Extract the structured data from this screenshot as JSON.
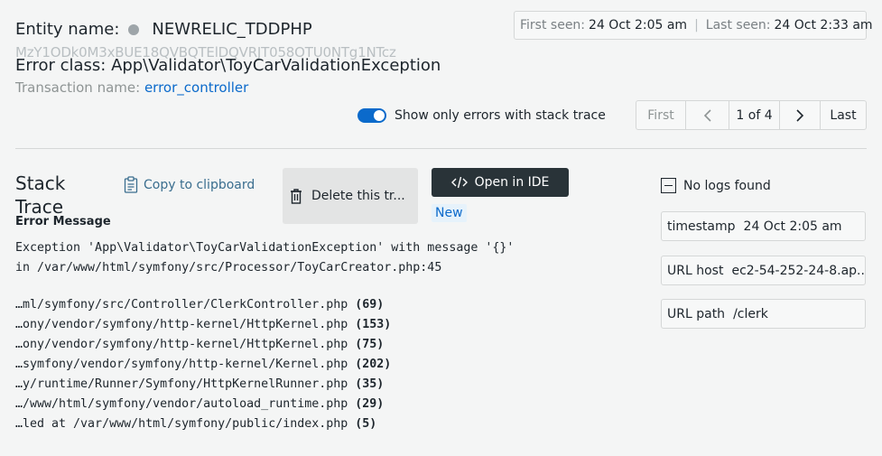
{
  "header": {
    "entity_label": "Entity name:",
    "entity_name": "NEWRELIC_TDDPHP",
    "entity_guid": "MzY1ODk0M3xBUE18QVBQTElDQVRJT058OTU0NTg1NTcz",
    "error_class": "Error class: App\\Validator\\ToyCarValidationException",
    "transaction_label": "Transaction name:",
    "transaction_name": "error_controller",
    "first_seen_label": "First seen:",
    "first_seen": "24 Oct 2:05 am",
    "separator": "|",
    "last_seen_label": "Last seen:",
    "last_seen": "24 Oct 2:33 am"
  },
  "controls": {
    "toggle_label": "Show only errors with stack trace",
    "toggle_on": true,
    "pager": {
      "first": "First",
      "prev": "‹",
      "current": "1 of 4",
      "next": "›",
      "last": "Last"
    }
  },
  "stack": {
    "title": "Stack Trace",
    "copy_label": "Copy to clipboard",
    "delete_label": "Delete this tr...",
    "open_ide_label": "Open in IDE",
    "new_badge": "New",
    "error_message_title": "Error Message",
    "exception_line1": "Exception 'App\\Validator\\ToyCarValidationException' with message '{}'",
    "exception_line2": "in /var/www/html/symfony/src/Processor/ToyCarCreator.php:45",
    "frames": [
      {
        "path": "…ml/symfony/src/Controller/",
        "file": "ClerkController.php",
        "line": "(69)"
      },
      {
        "path": "…ony/vendor/symfony/http-kernel/",
        "file": "HttpKernel.php",
        "line": "(153)"
      },
      {
        "path": "…ony/vendor/symfony/http-kernel/",
        "file": "HttpKernel.php",
        "line": "(75)"
      },
      {
        "path": "…symfony/vendor/symfony/http-kernel/",
        "file": "Kernel.php",
        "line": "(202)"
      },
      {
        "path": "…y/runtime/Runner/Symfony/",
        "file": "HttpKernelRunner.php",
        "line": "(35)"
      },
      {
        "path": "…/www/html/symfony/vendor/",
        "file": "autoload_runtime.php",
        "line": "(29)"
      },
      {
        "path": "…led at /var/www/html/symfony/public/",
        "file": "index.php",
        "line": "(5)"
      }
    ]
  },
  "logs": {
    "no_logs_label": "No logs found",
    "attributes": [
      {
        "key": "timestamp",
        "value": "24 Oct 2:05 am"
      },
      {
        "key": "URL host",
        "value": "ec2-54-252-24-8.ap..."
      },
      {
        "key": "URL path",
        "value": "/clerk"
      }
    ]
  },
  "colors": {
    "accent": "#0b6acb",
    "dark_button": "#293338",
    "background": "#f4f5f5"
  }
}
